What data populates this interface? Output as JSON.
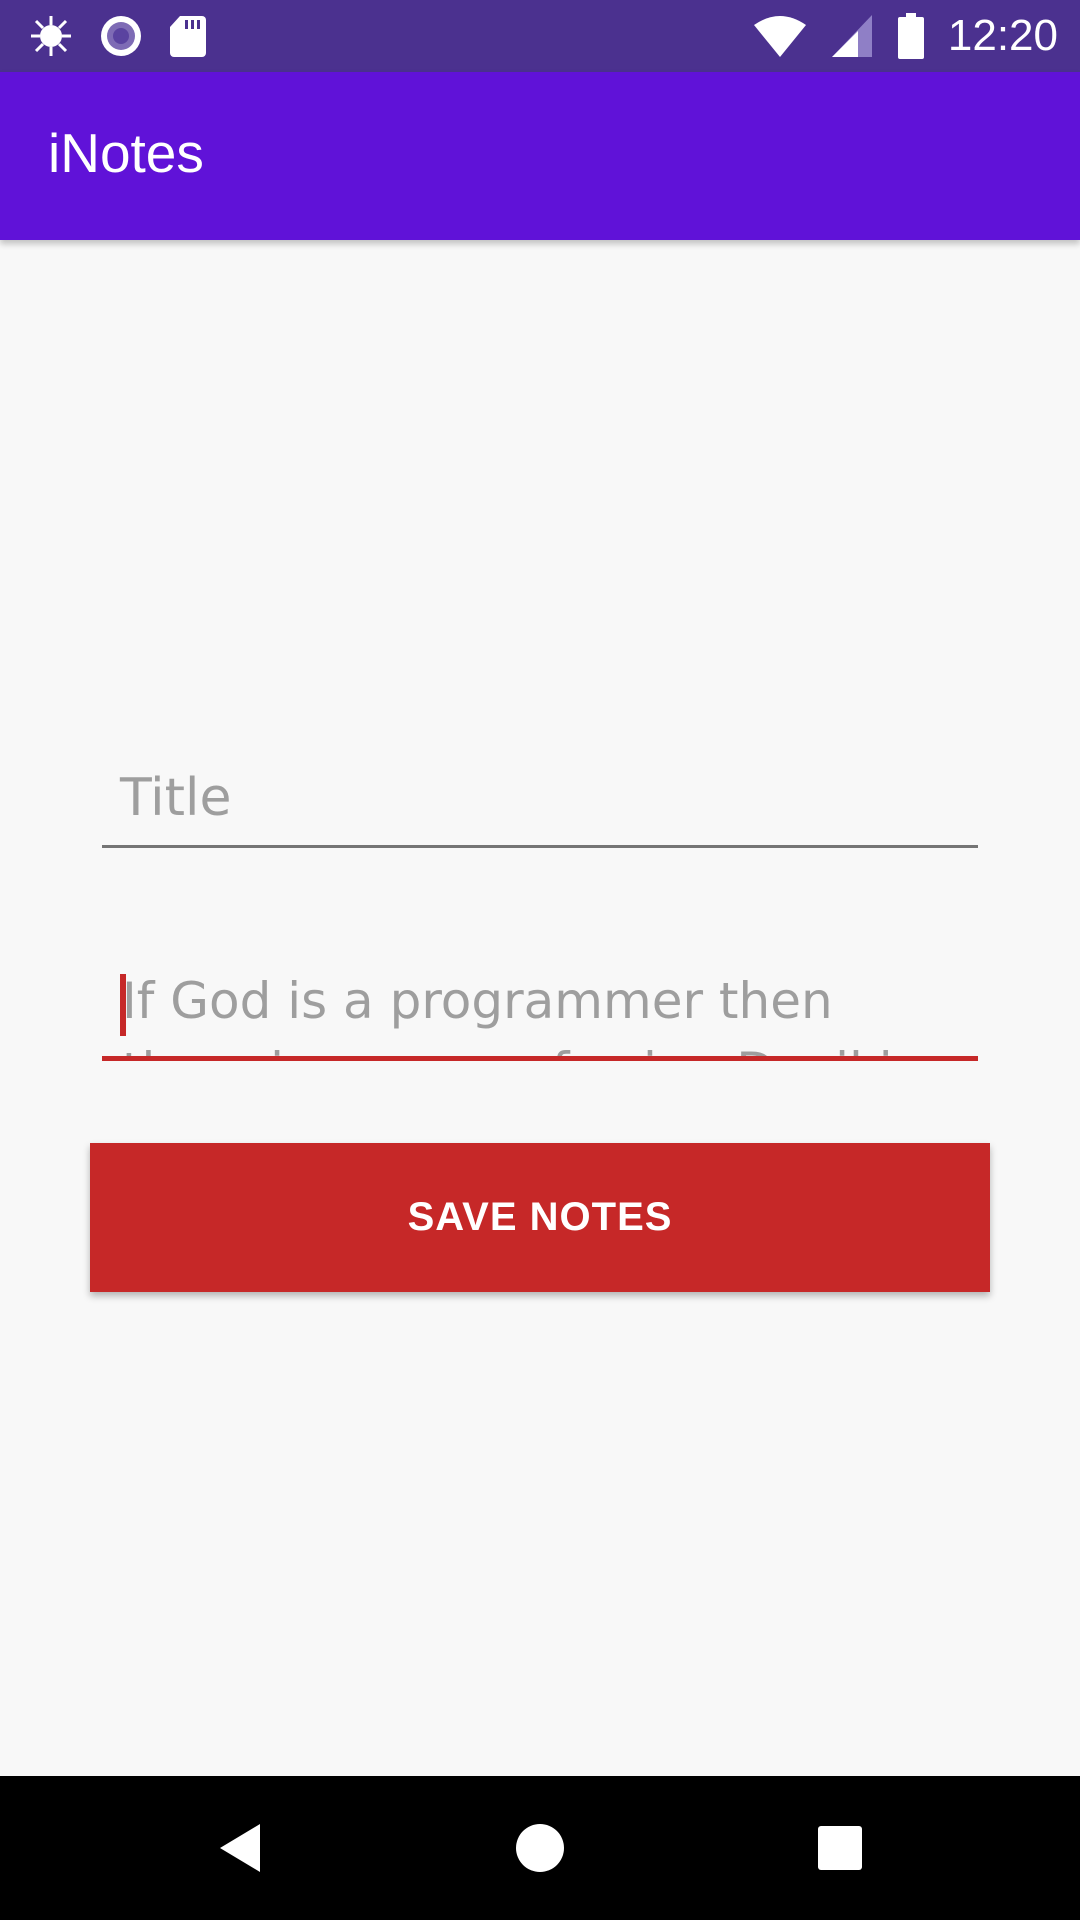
{
  "status_bar": {
    "time": "12:20",
    "icons": [
      "bug-icon",
      "circle-target-icon",
      "sd-card-icon",
      "wifi-icon",
      "cellular-signal-icon",
      "battery-icon"
    ]
  },
  "app_bar": {
    "title": "iNotes"
  },
  "form": {
    "title_placeholder": "Title",
    "title_value": "",
    "note_value": "If God is a programmer then there is no way of using Devil in a bad",
    "save_label": "SAVE NOTES"
  },
  "navigation": {
    "icons": [
      "back-icon",
      "home-icon",
      "recents-icon"
    ]
  },
  "colors": {
    "status_bar": "#4b318f",
    "app_bar": "#6012d8",
    "accent": "#c62828",
    "background": "#f8f8f8"
  }
}
